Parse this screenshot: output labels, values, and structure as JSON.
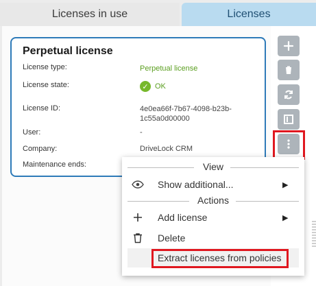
{
  "tabs": [
    {
      "label": "Licenses in use"
    },
    {
      "label": "Licenses"
    }
  ],
  "card": {
    "title": "Perpetual license",
    "fields": [
      {
        "label": "License type:",
        "value": "Perpetual license"
      },
      {
        "label": "License state:",
        "value": "OK"
      },
      {
        "label": "License ID:",
        "value": "4e0ea66f-7b67-4098-b23b-\n1c55a0d00000"
      },
      {
        "label": "User:",
        "value": "-"
      },
      {
        "label": "Company:",
        "value": "DriveLock CRM"
      },
      {
        "label": "Maintenance ends:",
        "value": ""
      }
    ]
  },
  "toolbar_icons": [
    "plus-icon",
    "trash-icon",
    "refresh-icon",
    "details-icon",
    "more-vertical-icon"
  ],
  "menu": {
    "section_view": "View",
    "show_additional": "Show additional...",
    "section_actions": "Actions",
    "add_license": "Add license",
    "delete": "Delete",
    "extract": "Extract licenses from policies"
  },
  "colors": {
    "tab_active": "#b9dbf0",
    "card_border": "#2d7ab8",
    "ok_green": "#77b82b",
    "highlight_red": "#e0171f",
    "toolbar_button": "#adb4ba"
  }
}
